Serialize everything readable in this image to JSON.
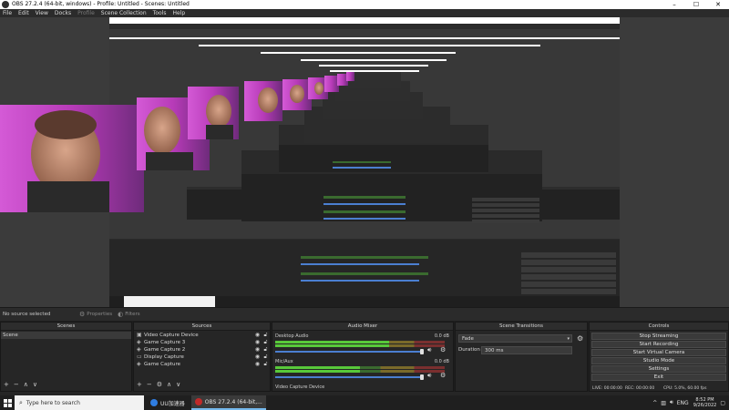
{
  "window": {
    "title": "OBS 27.2.4 (64-bit, windows) - Profile: Untitled - Scenes: Untitled",
    "controls": [
      "–",
      "☐",
      "✕"
    ]
  },
  "menu": {
    "items": [
      {
        "label": "File",
        "enabled": true
      },
      {
        "label": "Edit",
        "enabled": true
      },
      {
        "label": "View",
        "enabled": true
      },
      {
        "label": "Docks",
        "enabled": true
      },
      {
        "label": "Profile",
        "enabled": false
      },
      {
        "label": "Scene Collection",
        "enabled": true
      },
      {
        "label": "Tools",
        "enabled": true
      },
      {
        "label": "Help",
        "enabled": true
      }
    ]
  },
  "source_toolbar": {
    "no_source": "No source selected",
    "properties": "Properties",
    "filters": "Filters"
  },
  "scenes": {
    "header": "Scenes",
    "items": [
      "Scene"
    ],
    "footer": [
      "+",
      "−",
      "∧",
      "∨"
    ]
  },
  "sources": {
    "header": "Sources",
    "items": [
      {
        "label": "Video Capture Device",
        "icon": "camera-icon"
      },
      {
        "label": "Game Capture 3",
        "icon": "gamepad-icon"
      },
      {
        "label": "Game Capture 2",
        "icon": "gamepad-icon"
      },
      {
        "label": "Display Capture",
        "icon": "monitor-icon"
      },
      {
        "label": "Game Capture",
        "icon": "gamepad-icon"
      }
    ],
    "footer": [
      "+",
      "−",
      "⚙",
      "∧",
      "∨"
    ]
  },
  "mixer": {
    "header": "Audio Mixer",
    "channels": [
      {
        "name": "Desktop Audio",
        "db": "0.0 dB",
        "level": 0.67
      },
      {
        "name": "Mic/Aux",
        "db": "0.0 dB",
        "level": 0.5
      }
    ],
    "extra": "Video Capture Device"
  },
  "transitions": {
    "header": "Scene Transitions",
    "selected": "Fade",
    "duration_label": "Duration",
    "duration_value": "300 ms"
  },
  "controls": {
    "header": "Controls",
    "buttons": [
      "Stop Streaming",
      "Start Recording",
      "Start Virtual Camera",
      "Studio Mode",
      "Settings",
      "Exit"
    ]
  },
  "status": {
    "live": "LIVE: 00:00:00",
    "rec": "REC: 00:00:00",
    "cpu": "CPU: 5.0%, 60.00 fps"
  },
  "taskbar": {
    "search_placeholder": "Type here to search",
    "apps": [
      {
        "label": "UU加速器",
        "color": "#2f7de1"
      },
      {
        "label": "OBS 27.2.4 (64-bit,...",
        "color": "#c02a2a"
      }
    ],
    "language": "ENG",
    "time": "8:52 PM",
    "date": "9/26/2022"
  },
  "colors": {
    "panel": "#262626",
    "preview_bg": "#3b3b3b",
    "accent_blue": "#4b7fd1",
    "meter_green": "#58c93a"
  }
}
